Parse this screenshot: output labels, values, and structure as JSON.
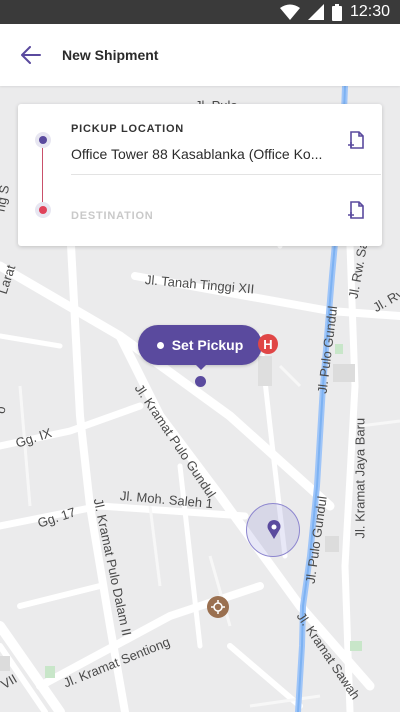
{
  "status_bar": {
    "time": "12:30"
  },
  "header": {
    "title": "New Shipment"
  },
  "card": {
    "pickup_label": "PICKUP LOCATION",
    "pickup_value": "Office Tower 88 Kasablanka (Office Ko...",
    "destination_placeholder": "DESTINATION"
  },
  "map": {
    "pickup_button": "Set Pickup",
    "hospital_badge": "H",
    "streets": {
      "tanah_tinggi": "Jl. Tanah Tinggi XII",
      "kramat_pulo_gundul": "Jl. Kramat Pulo Gundul",
      "pulo_gundul_top": "Jl. Pulo Gundul",
      "pulo_gundul_bottom": "Jl. Pulo Gundul",
      "kramat_jaya_baru": "Jl. Kramat Jaya Baru",
      "moh_saleh": "Jl. Moh. Saleh 1",
      "kramat_pulo_dalam": "Jl. Kramat Pulo Dalam II",
      "kramat_sentiong": "Jl. Kramat Sentiong",
      "kramat_sawah": "Jl. Kramat Sawah",
      "gg_ix": "Gg. IX",
      "gg_17": "Gg. 17",
      "rw_saw": "Jl. Rw. Saw",
      "ry": "Jl. Ry",
      "pulo_top": "Jl. Pulo",
      "larat": "Larat",
      "gang_s": "ng S",
      "vii": "VII",
      "do": "o"
    }
  }
}
